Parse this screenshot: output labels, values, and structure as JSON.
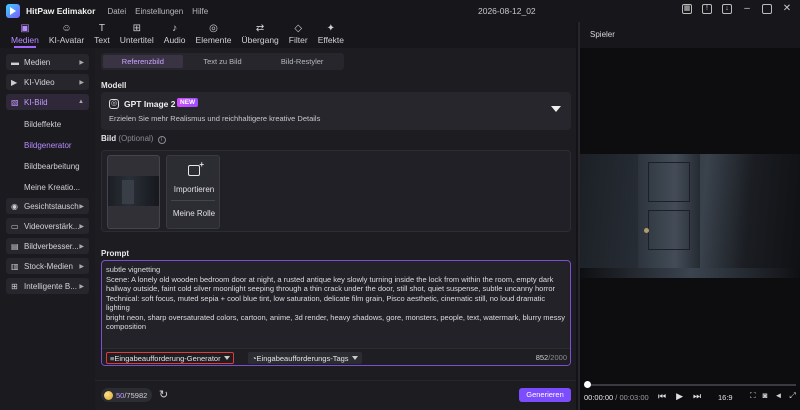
{
  "app": {
    "name": "HitPaw Edimakor",
    "menu": [
      "Datei",
      "Einstellungen",
      "Hilfe"
    ],
    "document_title": "2026-08-12_02"
  },
  "toolbar": [
    {
      "label": "Medien",
      "icon": "media-icon",
      "active": true
    },
    {
      "label": "KI-Avatar",
      "icon": "avatar-icon"
    },
    {
      "label": "Text",
      "icon": "text-icon"
    },
    {
      "label": "Untertitel",
      "icon": "subtitle-icon"
    },
    {
      "label": "Audio",
      "icon": "audio-icon"
    },
    {
      "label": "Elemente",
      "icon": "elements-icon"
    },
    {
      "label": "Übergang",
      "icon": "transition-icon"
    },
    {
      "label": "Filter",
      "icon": "filter-icon"
    },
    {
      "label": "Effekte",
      "icon": "effects-icon"
    }
  ],
  "sidebar": {
    "items": [
      {
        "label": "Medien",
        "icon": "folder-icon"
      },
      {
        "label": "KI-Video",
        "icon": "video-ai-icon"
      },
      {
        "label": "KI-Bild",
        "icon": "image-ai-icon",
        "open": true
      },
      {
        "label": "Gesichtstausch",
        "icon": "face-swap-icon"
      },
      {
        "label": "Videoverstärk...",
        "icon": "video-enhance-icon"
      },
      {
        "label": "Bildverbesser...",
        "icon": "image-enhance-icon"
      },
      {
        "label": "Stock-Medien",
        "icon": "stock-icon"
      },
      {
        "label": "Intelligente B...",
        "icon": "smart-icon"
      }
    ],
    "subitems": [
      "Bildeffekte",
      "Bildgenerator",
      "Bildbearbeitung",
      "Meine Kreatio..."
    ],
    "active_subitem": "Bildgenerator"
  },
  "tabs": [
    "Referenzbild",
    "Text zu Bild",
    "Bild-Restyler"
  ],
  "active_tab": "Referenzbild",
  "model": {
    "section_label": "Modell",
    "name": "GPT Image 2",
    "badge": "NEW",
    "description": "Erzielen Sie mehr Realismus und reichhaltigere kreative Details"
  },
  "image_section": {
    "label": "Bild",
    "optional": "(Optional)",
    "import_label": "Importieren",
    "role_label": "Meine Rolle"
  },
  "prompt": {
    "label": "Prompt",
    "text": "subtle vignetting\nScene: A lonely old wooden bedroom door at night, a rusted antique key slowly turning inside the lock from within the room, empty dark hallway outside, faint cold silver moonlight seeping through a thin crack under the door, still shot, quiet suspense, subtle uncanny horror\nTechnical: soft focus, muted sepia + cool blue tint, low saturation, delicate film grain, Pisco aesthetic, cinematic still, no loud dramatic lighting\nbright neon, sharp oversaturated colors, cartoon, anime, 3d render, heavy shadows, gore, monsters, people, text, watermark, blurry messy composition",
    "generator_button": "Eingabeaufforderung-Generator",
    "tags_button": "Eingabeaufforderungs-Tags",
    "count": "852",
    "max": "/2000"
  },
  "footer": {
    "credits_used": "50",
    "credits_total": "/75982",
    "generate_label": "Generieren"
  },
  "player": {
    "title": "Spieler",
    "current_time": "00:00:00",
    "total_time": "/ 00:03:00",
    "ratio": "16:9"
  },
  "colors": {
    "accent": "#a066ff",
    "generate": "#7c4dff",
    "highlight_border": "#e23a3a"
  }
}
